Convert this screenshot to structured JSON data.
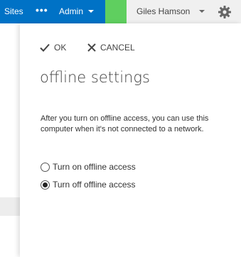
{
  "topbar": {
    "sites_label": "Sites",
    "more_label": "•••",
    "admin_label": "Admin",
    "user_name": "Giles Hamson",
    "settings_icon": "gear-icon",
    "colors": {
      "nav_blue": "#0072c6",
      "nav_green": "#5fcf5f",
      "bar_gray": "#f0f0f0"
    }
  },
  "panel": {
    "ok_label": "OK",
    "cancel_label": "CANCEL",
    "title": "offline settings",
    "description": "After you turn on offline access, you can use this computer when it's not connected to a network.",
    "options": [
      {
        "label": "Turn on offline access",
        "selected": false
      },
      {
        "label": "Turn off offline access",
        "selected": true
      }
    ]
  }
}
